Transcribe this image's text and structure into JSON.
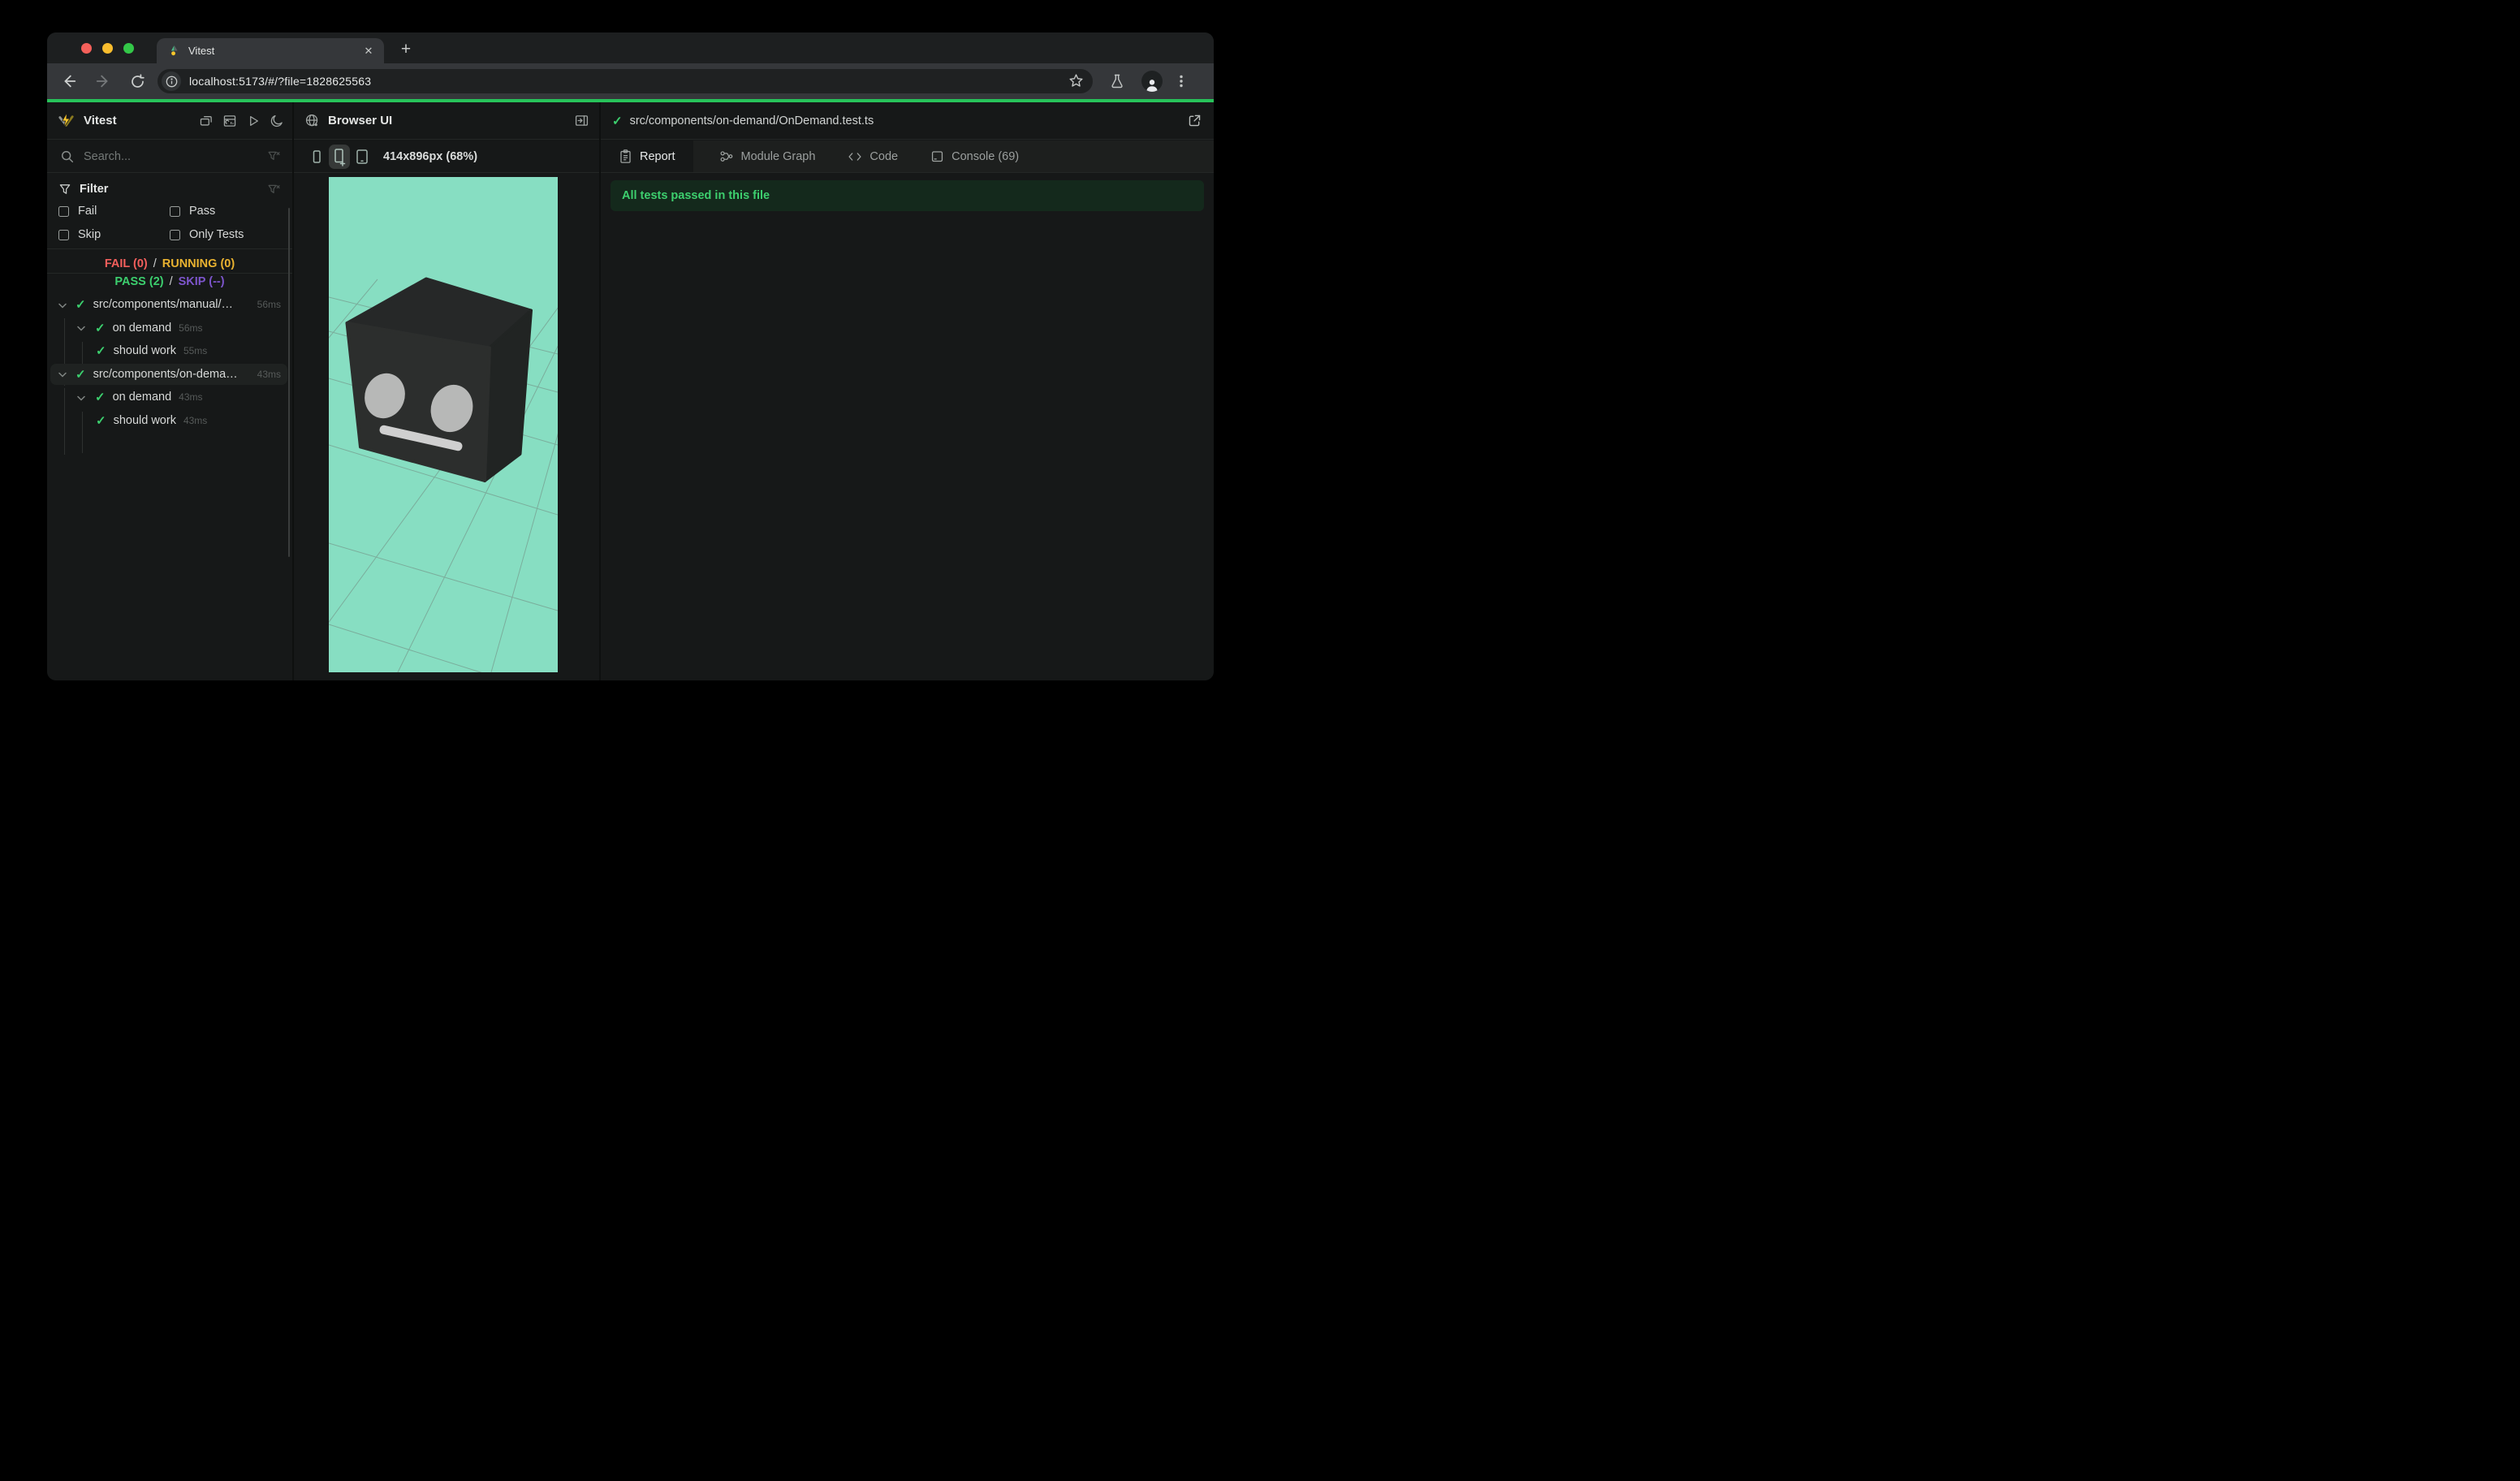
{
  "browser": {
    "tab_title": "Vitest",
    "url": "localhost:5173/#/?file=1828625563"
  },
  "sidebar": {
    "title": "Vitest",
    "search_placeholder": "Search...",
    "filter": {
      "label": "Filter",
      "fail": "Fail",
      "pass": "Pass",
      "skip": "Skip",
      "only_tests": "Only Tests"
    },
    "status": {
      "fail": "FAIL (0)",
      "sep1": "/",
      "running": "RUNNING (0)",
      "pass": "PASS (2)",
      "sep2": "/",
      "skip": "SKIP (--)"
    },
    "tree": [
      {
        "label": "src/components/manual/…",
        "duration": "56ms"
      },
      {
        "label": "on demand",
        "duration": "56ms"
      },
      {
        "label": "should work",
        "duration": "55ms"
      },
      {
        "label": "src/components/on-dema…",
        "duration": "43ms"
      },
      {
        "label": "on demand",
        "duration": "43ms"
      },
      {
        "label": "should work",
        "duration": "43ms"
      }
    ]
  },
  "preview": {
    "title": "Browser UI",
    "viewport": "414x896px (68%)"
  },
  "report": {
    "file": "src/components/on-demand/OnDemand.test.ts",
    "tabs": {
      "report": "Report",
      "module_graph": "Module Graph",
      "code": "Code",
      "console": "Console (69)"
    },
    "banner": "All tests passed in this file"
  },
  "scene": {
    "bg": "#87dec2",
    "grid": "#6f7d76",
    "cube_top": "#262828",
    "cube_front": "#2c2e2d",
    "cube_right": "#212423",
    "eye": "#b7b8b7",
    "mouth": "#cfcfcf"
  },
  "colors": {
    "progress_bar": "#27c25a",
    "fail": "#f25f5c",
    "running": "#e9b230",
    "pass": "#3ccf6e",
    "skip": "#7d55cc",
    "banner_text": "#3dcf6e",
    "check": "#3ccf6e"
  }
}
